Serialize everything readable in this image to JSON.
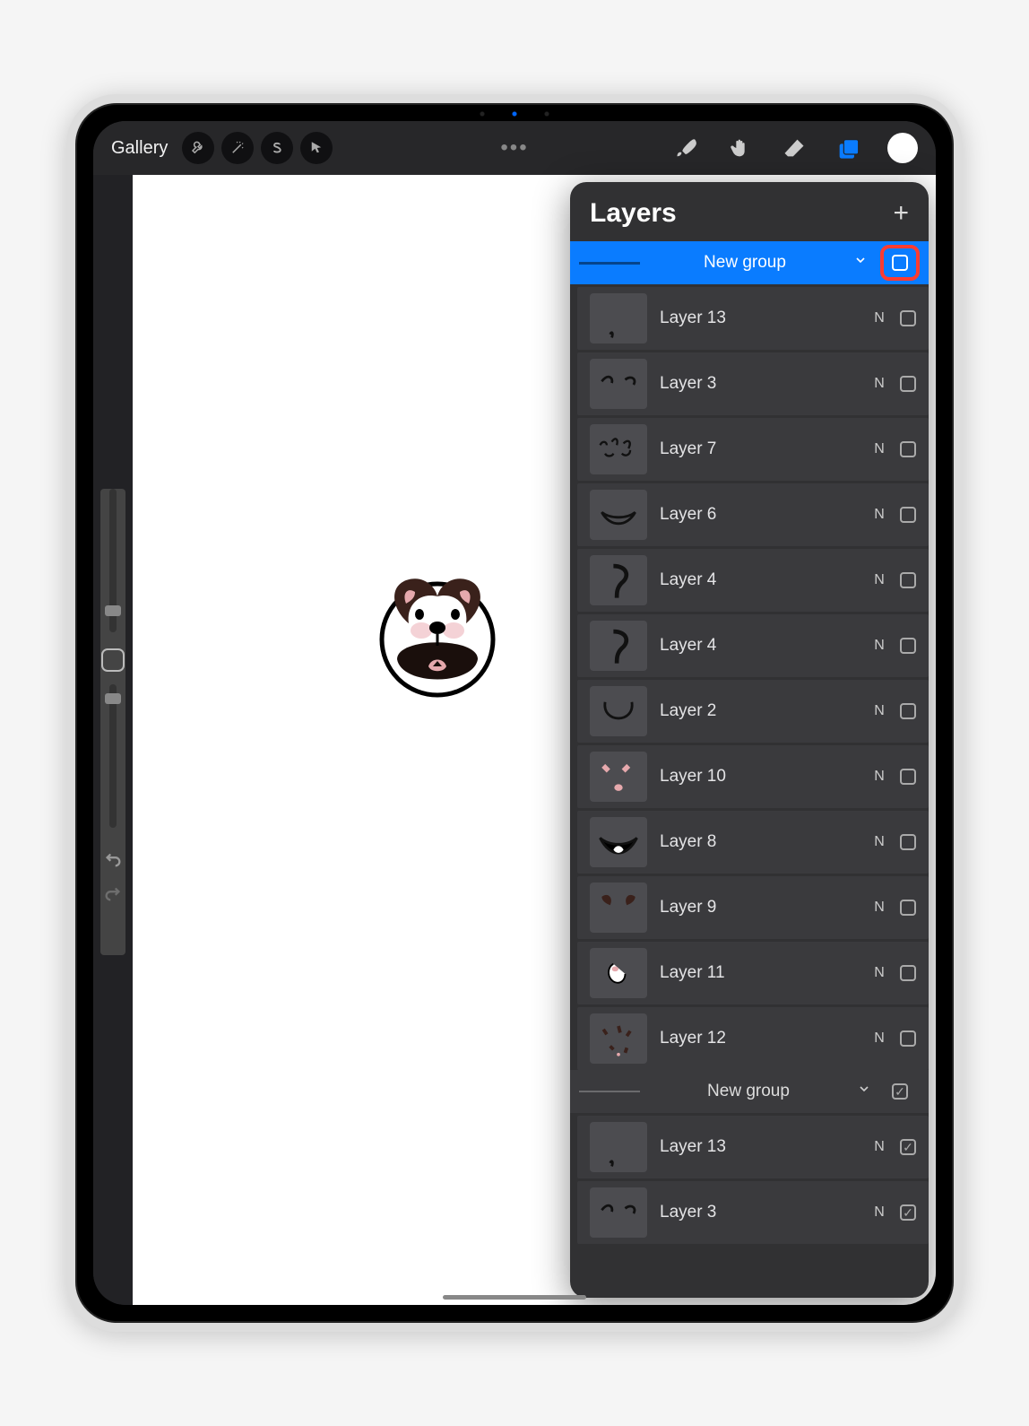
{
  "toolbar": {
    "gallery_label": "Gallery"
  },
  "panel": {
    "title": "Layers"
  },
  "groups": [
    {
      "name": "New group",
      "selected": true,
      "visible": false
    },
    {
      "name": "New group",
      "selected": false,
      "visible": true
    }
  ],
  "layers_group1": [
    {
      "name": "Layer 13",
      "blend": "N",
      "visible": false
    },
    {
      "name": "Layer 3",
      "blend": "N",
      "visible": false
    },
    {
      "name": "Layer 7",
      "blend": "N",
      "visible": false
    },
    {
      "name": "Layer 6",
      "blend": "N",
      "visible": false
    },
    {
      "name": "Layer 4",
      "blend": "N",
      "visible": false
    },
    {
      "name": "Layer 4",
      "blend": "N",
      "visible": false
    },
    {
      "name": "Layer 2",
      "blend": "N",
      "visible": false
    },
    {
      "name": "Layer 10",
      "blend": "N",
      "visible": false
    },
    {
      "name": "Layer 8",
      "blend": "N",
      "visible": false
    },
    {
      "name": "Layer 9",
      "blend": "N",
      "visible": false
    },
    {
      "name": "Layer 11",
      "blend": "N",
      "visible": false
    },
    {
      "name": "Layer 12",
      "blend": "N",
      "visible": false
    }
  ],
  "layers_group2": [
    {
      "name": "Layer 13",
      "blend": "N",
      "visible": true
    },
    {
      "name": "Layer 3",
      "blend": "N",
      "visible": true
    }
  ]
}
